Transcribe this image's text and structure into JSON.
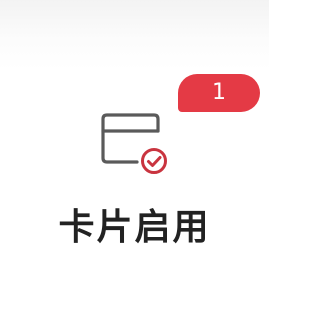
{
  "tile": {
    "label": "卡片启用",
    "badge_count": "1",
    "icon": "card-check-icon",
    "colors": {
      "badge": "#e43a45",
      "icon_stroke": "#5a5a5a",
      "check_stroke": "#c9343f",
      "label_text": "#222222"
    }
  }
}
